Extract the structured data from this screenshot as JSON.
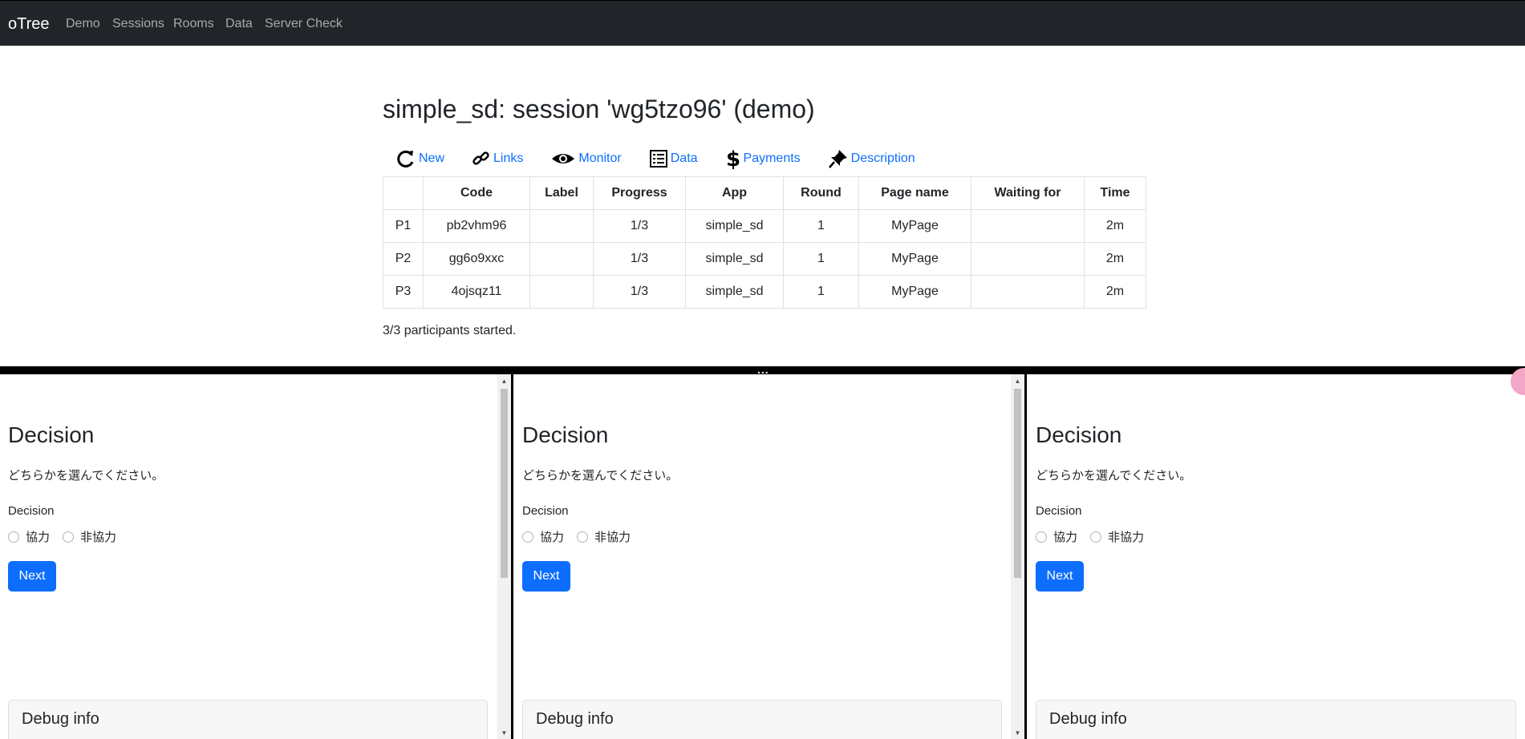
{
  "navbar": {
    "brand": "oTree",
    "links": [
      "Demo",
      "Sessions",
      "Rooms",
      "Data",
      "Server Check"
    ]
  },
  "session": {
    "title": "simple_sd: session 'wg5tzo96' (demo)",
    "tools": [
      {
        "label": "New",
        "icon": "refresh-icon"
      },
      {
        "label": "Links",
        "icon": "link-icon"
      },
      {
        "label": "Monitor",
        "icon": "eye-icon"
      },
      {
        "label": "Data",
        "icon": "list-icon"
      },
      {
        "label": "Payments",
        "icon": "dollar-icon"
      },
      {
        "label": "Description",
        "icon": "pin-icon"
      }
    ],
    "table": {
      "columns": [
        "",
        "Code",
        "Label",
        "Progress",
        "App",
        "Round",
        "Page name",
        "Waiting for",
        "Time"
      ],
      "rows": [
        [
          "P1",
          "pb2vhm96",
          "",
          "1/3",
          "simple_sd",
          "1",
          "MyPage",
          "",
          "2m"
        ],
        [
          "P2",
          "gg6o9xxc",
          "",
          "1/3",
          "simple_sd",
          "1",
          "MyPage",
          "",
          "2m"
        ],
        [
          "P3",
          "4ojsqz11",
          "",
          "1/3",
          "simple_sd",
          "1",
          "MyPage",
          "",
          "2m"
        ]
      ]
    },
    "status": "3/3 participants started."
  },
  "divider_handle": "...",
  "panes": [
    {
      "title": "Decision",
      "instruction": "どちらかを選んでください。",
      "field_label": "Decision",
      "options": [
        "協力",
        "非協力"
      ],
      "next_label": "Next",
      "debug_title": "Debug info"
    },
    {
      "title": "Decision",
      "instruction": "どちらかを選んでください。",
      "field_label": "Decision",
      "options": [
        "協力",
        "非協力"
      ],
      "next_label": "Next",
      "debug_title": "Debug info"
    },
    {
      "title": "Decision",
      "instruction": "どちらかを選んでください。",
      "field_label": "Decision",
      "options": [
        "協力",
        "非協力"
      ],
      "next_label": "Next",
      "debug_title": "Debug info"
    }
  ],
  "colors": {
    "navbar": "#212529",
    "link": "#0d6efd",
    "button": "#0d6efd"
  }
}
